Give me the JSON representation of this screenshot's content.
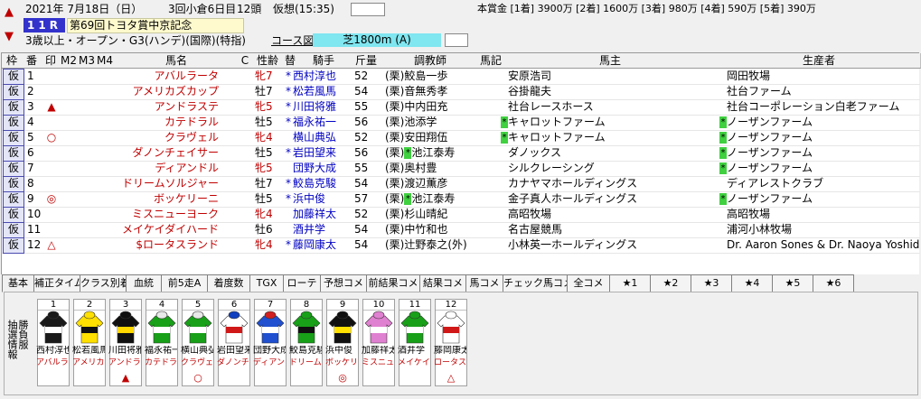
{
  "race": {
    "date": "2021年 7月18日（日）",
    "meet": "3回小倉6日目",
    "head_count": "12頭",
    "forecast_label": "仮想(15:35)",
    "race_no": "11R",
    "title": "第69回トヨタ賞中京記念",
    "conditions": "3歳以上・オープン・G3(ハンデ)(国際)(特指)",
    "course_label": "コース図",
    "course": "芝1800m (A)",
    "prize": "本賞金 [1着] 3900万 [2着] 1600万 [3着] 980万 [4着] 590万 [5着] 390万"
  },
  "columns": [
    "枠",
    "番",
    "印",
    "M2",
    "M3",
    "M4",
    "馬名",
    "C",
    "性齢",
    "替",
    "騎手",
    "斤量",
    "調教師",
    "馬記",
    "馬主",
    "生産者"
  ],
  "horses": [
    {
      "waku": "仮",
      "num": "1",
      "mark": "",
      "name": "アバルラータ",
      "sex": "牝7",
      "swap": "*",
      "jockey": "西村淳也",
      "weight": "52",
      "trainer": "(栗)鮫島一歩",
      "trmark": "",
      "owner": "安原浩司",
      "ownmark": "",
      "breeder": "岡田牧場",
      "brmark": ""
    },
    {
      "waku": "仮",
      "num": "2",
      "mark": "",
      "name": "アメリカズカップ",
      "sex": "牡7",
      "swap": "*",
      "jockey": "松若風馬",
      "weight": "54",
      "trainer": "(栗)音無秀孝",
      "trmark": "",
      "owner": "谷掛龍夫",
      "ownmark": "",
      "breeder": "社台ファーム",
      "brmark": ""
    },
    {
      "waku": "仮",
      "num": "3",
      "mark": "▲",
      "name": "アンドラステ",
      "sex": "牝5",
      "swap": "*",
      "jockey": "川田将雅",
      "weight": "55",
      "trainer": "(栗)中内田充",
      "trmark": "",
      "owner": "社台レースホース",
      "ownmark": "",
      "breeder": "社台コーポレーション白老ファーム",
      "brmark": ""
    },
    {
      "waku": "仮",
      "num": "4",
      "mark": "",
      "name": "カテドラル",
      "sex": "牡5",
      "swap": "*",
      "jockey": "福永祐一",
      "weight": "56",
      "trainer": "(栗)池添学",
      "trmark": "",
      "owner": "キャロットファーム",
      "ownmark": "*",
      "breeder": "ノーザンファーム",
      "brmark": "*"
    },
    {
      "waku": "仮",
      "num": "5",
      "mark": "○",
      "name": "クラヴェル",
      "sex": "牝4",
      "swap": "",
      "jockey": "横山典弘",
      "weight": "52",
      "trainer": "(栗)安田翔伍",
      "trmark": "",
      "owner": "キャロットファーム",
      "ownmark": "*",
      "breeder": "ノーザンファーム",
      "brmark": "*"
    },
    {
      "waku": "仮",
      "num": "6",
      "mark": "",
      "name": "ダノンチェイサー",
      "sex": "牡5",
      "swap": "*",
      "jockey": "岩田望来",
      "weight": "56",
      "trainer": "(栗)池江泰寿",
      "trmark": "*",
      "owner": "ダノックス",
      "ownmark": "",
      "breeder": "ノーザンファーム",
      "brmark": "*"
    },
    {
      "waku": "仮",
      "num": "7",
      "mark": "",
      "name": "ディアンドル",
      "sex": "牝5",
      "swap": "",
      "jockey": "団野大成",
      "weight": "55",
      "trainer": "(栗)奥村豊",
      "trmark": "",
      "owner": "シルクレーシング",
      "ownmark": "",
      "breeder": "ノーザンファーム",
      "brmark": "*"
    },
    {
      "waku": "仮",
      "num": "8",
      "mark": "",
      "name": "ドリームソルジャー",
      "sex": "牡7",
      "swap": "*",
      "jockey": "鮫島克駿",
      "weight": "54",
      "trainer": "(栗)渡辺薫彦",
      "trmark": "",
      "owner": "カナヤマホールディングス",
      "ownmark": "",
      "breeder": "ディアレストクラブ",
      "brmark": ""
    },
    {
      "waku": "仮",
      "num": "9",
      "mark": "◎",
      "name": "ボッケリーニ",
      "sex": "牡5",
      "swap": "*",
      "jockey": "浜中俊",
      "weight": "57",
      "trainer": "(栗)池江泰寿",
      "trmark": "*",
      "owner": "金子真人ホールディングス",
      "ownmark": "",
      "breeder": "ノーザンファーム",
      "brmark": "*"
    },
    {
      "waku": "仮",
      "num": "10",
      "mark": "",
      "name": "ミスニューヨーク",
      "sex": "牝4",
      "swap": "",
      "jockey": "加藤祥太",
      "weight": "52",
      "trainer": "(栗)杉山晴紀",
      "trmark": "",
      "owner": "高昭牧場",
      "ownmark": "",
      "breeder": "高昭牧場",
      "brmark": ""
    },
    {
      "waku": "仮",
      "num": "11",
      "mark": "",
      "name": "メイケイダイハード",
      "sex": "牡6",
      "swap": "",
      "jockey": "酒井学",
      "weight": "54",
      "trainer": "(栗)中竹和也",
      "trmark": "",
      "owner": "名古屋競馬",
      "ownmark": "",
      "breeder": "浦河小林牧場",
      "brmark": ""
    },
    {
      "waku": "仮",
      "num": "12",
      "mark": "△",
      "name": "$ロータスランド",
      "sex": "牝4",
      "swap": "*",
      "jockey": "藤岡康太",
      "weight": "54",
      "trainer": "(栗)辻野泰之(外)",
      "trmark": "",
      "owner": "小林英一ホールディングス",
      "ownmark": "",
      "breeder": "Dr. Aaron Sones & Dr. Naoya Yoshida",
      "brmark": ""
    }
  ],
  "tabs": [
    "基本",
    "補正タイム",
    "クラス別着",
    "血統",
    "前5走A",
    "着度数",
    "TGX",
    "ローテ",
    "予想コメ",
    "前結果コメ",
    "結果コメ",
    "馬コメ",
    "チェック馬コメ",
    "全コメ",
    "★1",
    "★2",
    "★3",
    "★4",
    "★5",
    "★6"
  ],
  "silk_panel": {
    "side_label_1": "抽選情報",
    "side_label_2": "勝負服"
  },
  "silks": [
    {
      "num": "1",
      "jockey": "西村淳也",
      "horse": "アバルラータ",
      "mark": "",
      "colors": [
        "#1a1a1a",
        "#ffffff",
        "#1a1a1a"
      ]
    },
    {
      "num": "2",
      "jockey": "松若風馬",
      "horse": "アメリカズカップ",
      "mark": "",
      "colors": [
        "#ffe000",
        "#101010",
        "#ffe000"
      ]
    },
    {
      "num": "3",
      "jockey": "川田将雅",
      "horse": "アンドラステ",
      "mark": "▲",
      "colors": [
        "#101010",
        "#ffd800",
        "#101010"
      ]
    },
    {
      "num": "4",
      "jockey": "福永祐一",
      "horse": "カテドラル",
      "mark": "",
      "colors": [
        "#18a018",
        "#ffffff",
        "#e8e8e8"
      ]
    },
    {
      "num": "5",
      "jockey": "横山典弘",
      "horse": "クラヴェル",
      "mark": "○",
      "colors": [
        "#18a018",
        "#ffffff",
        "#e8e8e8"
      ]
    },
    {
      "num": "6",
      "jockey": "岩田望来",
      "horse": "ダノンチェイサー",
      "mark": "",
      "colors": [
        "#ffffff",
        "#d01818",
        "#1040c0"
      ]
    },
    {
      "num": "7",
      "jockey": "団野大成",
      "horse": "ディアンドル",
      "mark": "",
      "colors": [
        "#2050d0",
        "#ffffff",
        "#d02020"
      ]
    },
    {
      "num": "8",
      "jockey": "鮫島克駿",
      "horse": "ドリームソルジャー",
      "mark": "",
      "colors": [
        "#18a018",
        "#101010",
        "#18a018"
      ]
    },
    {
      "num": "9",
      "jockey": "浜中俊",
      "horse": "ボッケリーニ",
      "mark": "◎",
      "colors": [
        "#101010",
        "#ffe000",
        "#101010"
      ]
    },
    {
      "num": "10",
      "jockey": "加藤祥太",
      "horse": "ミスニューヨーク",
      "mark": "",
      "colors": [
        "#e080d0",
        "#ffffff",
        "#e080d0"
      ]
    },
    {
      "num": "11",
      "jockey": "酒井学",
      "horse": "メイケイダイハード",
      "mark": "",
      "colors": [
        "#18a018",
        "#ffffff",
        "#18a018"
      ]
    },
    {
      "num": "12",
      "jockey": "藤岡康太",
      "horse": "ロータスランド",
      "mark": "△",
      "colors": [
        "#ffffff",
        "#d01818",
        "#ffffff"
      ]
    }
  ]
}
